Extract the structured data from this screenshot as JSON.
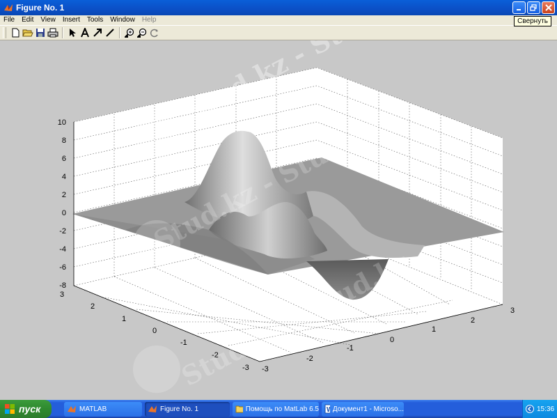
{
  "window": {
    "title": "Figure No. 1",
    "tooltip": "Свернуть",
    "controls": [
      "minimize-icon",
      "maximize-icon",
      "close-icon"
    ]
  },
  "menu": [
    "File",
    "Edit",
    "View",
    "Insert",
    "Tools",
    "Window",
    "Help"
  ],
  "toolbar": [
    "new-file-icon",
    "open-file-icon",
    "save-icon",
    "print-icon",
    "arrow-select-icon",
    "insert-text-icon",
    "insert-arrow-icon",
    "insert-line-icon",
    "zoom-in-icon",
    "zoom-out-icon",
    "rotate-3d-icon"
  ],
  "plot": {
    "type": "3d-surface",
    "z_ticks": [
      "10",
      "8",
      "6",
      "4",
      "2",
      "0",
      "-2",
      "-4",
      "-6",
      "-8"
    ],
    "y_ticks": [
      "3",
      "2",
      "1",
      "0",
      "-1",
      "-2",
      "-3"
    ],
    "x_ticks": [
      "-3",
      "-2",
      "-1",
      "0",
      "1",
      "2",
      "3"
    ],
    "surface_color": "#9a9a9a",
    "watermark": "Stud.kz - Stud.kz"
  },
  "taskbar": {
    "start_label": "пуск",
    "tasks": [
      {
        "label": "MATLAB",
        "active": false
      },
      {
        "label": "Figure No. 1",
        "active": true
      },
      {
        "label": "Помощь по MatLab 6.5",
        "active": false
      },
      {
        "label": "Документ1 - Microso...",
        "active": false
      }
    ],
    "clock": "15:36"
  }
}
